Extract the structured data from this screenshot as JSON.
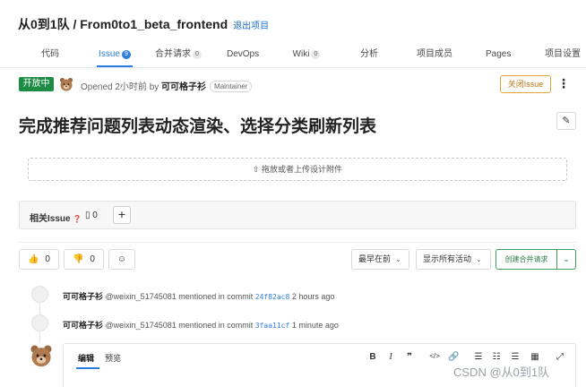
{
  "header": {
    "title": "从0到1队 / From0to1_beta_frontend",
    "exit_link": "退出项目"
  },
  "tabs": [
    {
      "label": "代码",
      "badge": ""
    },
    {
      "label": "Issue",
      "badge": "9",
      "active": true
    },
    {
      "label": "合并请求",
      "badge": "0"
    },
    {
      "label": "DevOps",
      "badge": ""
    },
    {
      "label": "Wiki",
      "badge": "0"
    },
    {
      "label": "分析",
      "badge": ""
    },
    {
      "label": "项目成员",
      "badge": ""
    },
    {
      "label": "Pages",
      "badge": ""
    },
    {
      "label": "项目设置",
      "badge": ""
    }
  ],
  "issue": {
    "status": "开放中",
    "opened_text": "Opened 2小时前 by",
    "author": "可可格子衫",
    "role": "Maintainer",
    "close_button": "关闭Issue",
    "title": "完成推荐问题列表动态渲染、选择分类刷新列表",
    "dropzone_text": "拖放或者上传设计附件"
  },
  "related": {
    "label": "相关Issue",
    "count": "0"
  },
  "reactions": {
    "thumbs_up": "0",
    "thumbs_down": "0"
  },
  "controls": {
    "sort": "最早在前",
    "filter": "显示所有活动",
    "create_mr": "创建合并请求"
  },
  "timeline": [
    {
      "author": "可可格子衫",
      "text": "@weixin_51745081 mentioned in commit",
      "commit": "24f82ac8",
      "time": "2 hours ago"
    },
    {
      "author": "可可格子衫",
      "text": "@weixin_51745081 mentioned in commit",
      "commit": "3faa11cf",
      "time": "1 minute ago"
    }
  ],
  "editor": {
    "tab_edit": "编辑",
    "tab_preview": "预览"
  },
  "watermark": "CSDN @从0到1队",
  "colors": {
    "accent": "#2e7ee0",
    "open_status": "#1e8b45",
    "close_button": "#e6a23c",
    "create_mr": "#3e9e58"
  }
}
